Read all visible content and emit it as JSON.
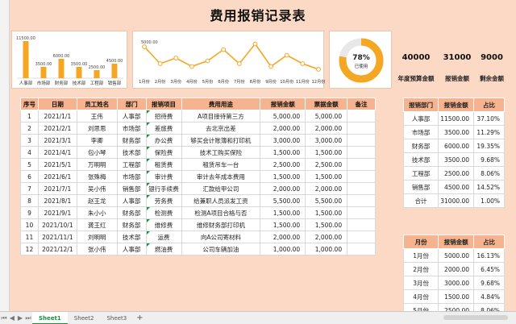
{
  "title": "费用报销记录表",
  "bar_chart": {
    "categories": [
      "人事部",
      "市场部",
      "财务部",
      "技术部",
      "工程部",
      "销售部"
    ],
    "values": [
      11500,
      3500,
      6000,
      3500,
      2500,
      4500
    ],
    "value_labels": [
      "11500.00",
      "3500.00",
      "6000.00",
      "3500.00",
      "2500.00",
      "4500.00"
    ],
    "ymax": 12000,
    "color": "#f5a623"
  },
  "line_chart": {
    "categories": [
      "1月份",
      "2月份",
      "3月份",
      "4月份",
      "5月份",
      "6月份",
      "7月份",
      "8月份",
      "9月份",
      "10月份",
      "11月份",
      "12月份"
    ],
    "values": [
      5000,
      2000,
      3000,
      1500,
      2500,
      4500,
      2000,
      5500,
      1500,
      3500,
      2000,
      1000
    ],
    "first_label": "5000.00",
    "ymax": 6000,
    "color": "#f5a623"
  },
  "donut": {
    "percent": 78,
    "label": "78%",
    "sub": "已使用",
    "color": "#f5a623",
    "track": "#e8e8e8"
  },
  "kpis": [
    {
      "value": "40000",
      "label": "年度预算金额"
    },
    {
      "value": "31000",
      "label": "报销金额"
    },
    {
      "value": "9000",
      "label": "剩余金额"
    }
  ],
  "main_table": {
    "headers": [
      "序号",
      "日期",
      "员工姓名",
      "部门",
      "报销项目",
      "费用用途",
      "报销金额",
      "票据金额",
      "备注"
    ],
    "rows": [
      [
        "1",
        "2021/1/1",
        "王伟",
        "人事部",
        "招待费",
        "A项目接待第三方",
        "5,000.00",
        "5,000.00",
        ""
      ],
      [
        "2",
        "2021/2/1",
        "刘思思",
        "市场部",
        "差旅费",
        "去北京出差",
        "2,000.00",
        "2,000.00",
        ""
      ],
      [
        "3",
        "2021/3/1",
        "李卿",
        "财务部",
        "办公费",
        "够买会计账簿和打印机",
        "3,000.00",
        "3,000.00",
        ""
      ],
      [
        "4",
        "2021/4/1",
        "包小琴",
        "技术部",
        "保险费",
        "技术工购买保险",
        "1,500.00",
        "1,500.00",
        ""
      ],
      [
        "5",
        "2021/5/1",
        "万明明",
        "工程部",
        "租赁费",
        "租赁吊车一台",
        "2,500.00",
        "2,500.00",
        ""
      ],
      [
        "6",
        "2021/6/1",
        "张殊梅",
        "市场部",
        "审计费",
        "审计去年成本费用",
        "1,500.00",
        "1,500.00",
        ""
      ],
      [
        "7",
        "2021/7/1",
        "吴小伟",
        "销售部",
        "银行手续费",
        "汇款给甲公司",
        "2,000.00",
        "2,000.00",
        ""
      ],
      [
        "8",
        "2021/8/1",
        "赵王龙",
        "人事部",
        "劳务费",
        "给兼职人员派发工资",
        "5,500.00",
        "5,500.00",
        ""
      ],
      [
        "9",
        "2021/9/1",
        "朱小小",
        "财务部",
        "检测费",
        "检测A项目合格与否",
        "1,500.00",
        "1,500.00",
        ""
      ],
      [
        "10",
        "2021/10/1",
        "龚王红",
        "财务部",
        "维修费",
        "维修财务部打印机",
        "1,500.00",
        "1,500.00",
        ""
      ],
      [
        "11",
        "2021/11/1",
        "刘明明",
        "技术部",
        "运费",
        "向A公司寄材料",
        "2,000.00",
        "2,000.00",
        ""
      ],
      [
        "12",
        "2021/12/1",
        "张小伟",
        "人事部",
        "燃油费",
        "公司车辆加油",
        "1,000.00",
        "1,000.00",
        ""
      ]
    ]
  },
  "dept_table": {
    "headers": [
      "报销部门",
      "报销金额",
      "占比"
    ],
    "rows": [
      [
        "人事部",
        "11500.00",
        "37.10%"
      ],
      [
        "市场部",
        "3500.00",
        "11.29%"
      ],
      [
        "财务部",
        "6000.00",
        "19.35%"
      ],
      [
        "技术部",
        "3500.00",
        "9.68%"
      ],
      [
        "工程部",
        "2500.00",
        "8.06%"
      ],
      [
        "销售部",
        "4500.00",
        "14.52%"
      ],
      [
        "合计",
        "31000.00",
        "1.00%"
      ]
    ]
  },
  "month_table": {
    "headers": [
      "月份",
      "报销金额",
      "占比"
    ],
    "rows": [
      [
        "1月份",
        "5000.00",
        "16.13%"
      ],
      [
        "2月份",
        "2000.00",
        "6.45%"
      ],
      [
        "3月份",
        "3000.00",
        "9.68%"
      ],
      [
        "4月份",
        "1500.00",
        "4.84%"
      ],
      [
        "5月份",
        "2500.00",
        "8.06%"
      ]
    ]
  },
  "tabs": [
    "Sheet1",
    "Sheet2",
    "Sheet3"
  ],
  "add_tab": "+"
}
